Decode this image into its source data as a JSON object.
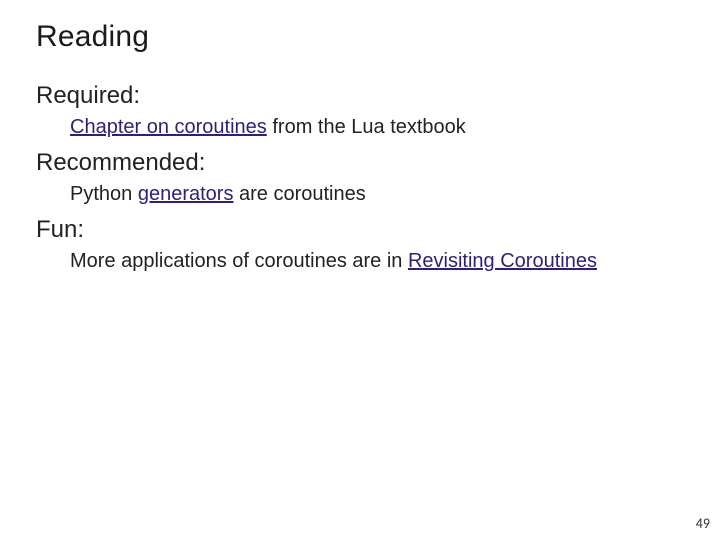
{
  "title": "Reading",
  "sections": {
    "required": {
      "heading": "Required:",
      "item_link": "Chapter on coroutines",
      "item_rest": " from the Lua textbook"
    },
    "recommended": {
      "heading": "Recommended:",
      "item_pre": "Python ",
      "item_link": "generators",
      "item_rest": " are coroutines"
    },
    "fun": {
      "heading": "Fun:",
      "item_pre": "More applications of coroutines are in ",
      "item_link": "Revisiting Coroutines"
    }
  },
  "page_number": "49"
}
